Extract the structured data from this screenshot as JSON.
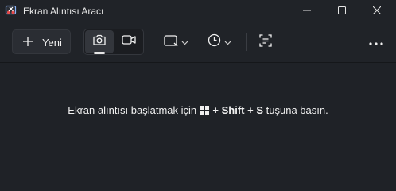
{
  "window": {
    "title": "Ekran Alıntısı Aracı",
    "icon": "snipping-tool-app-icon",
    "controls": [
      "minimize-icon",
      "maximize-icon",
      "close-icon"
    ]
  },
  "toolbar": {
    "new_label": "Yeni",
    "new_icon": "plus-icon",
    "modes": [
      {
        "icon": "camera-icon",
        "active": true
      },
      {
        "icon": "video-icon",
        "active": false
      }
    ],
    "shape_icon": "rectangle-snip-icon",
    "delay_icon": "timer-icon",
    "text_actions_icon": "text-recognition-icon",
    "more_icon": "more-dots-icon"
  },
  "main": {
    "hint_prefix": "Ekran alıntısı başlatmak için",
    "hint_key_plus1": "+",
    "hint_shift": "Shift",
    "hint_key_plus2": "+",
    "hint_s": "S",
    "hint_suffix": "tuşuna basın."
  },
  "colors": {
    "background": "#1f2227",
    "titlebar": "#202328",
    "text": "#ffffff",
    "button_bg": "#2a2d33"
  }
}
